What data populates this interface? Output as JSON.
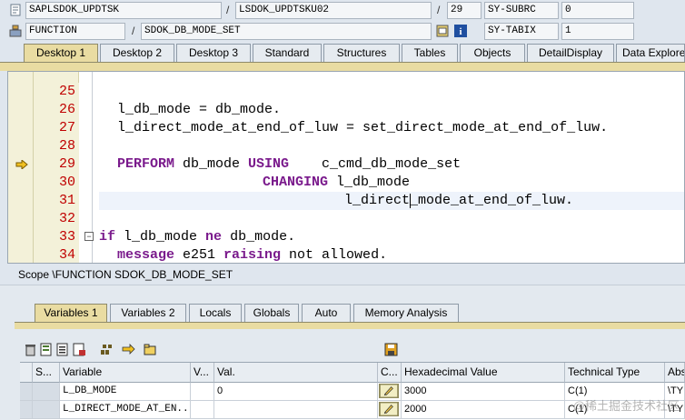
{
  "header": {
    "program": "SAPLSDOK_UPDTSK",
    "include": "LSDOK_UPDTSKU02",
    "line": "29",
    "sysvar1_name": "SY-SUBRC",
    "sysvar1_value": "0",
    "event_type": "FUNCTION",
    "event_name": "SDOK_DB_MODE_SET",
    "sysvar2_name": "SY-TABIX",
    "sysvar2_value": "1"
  },
  "main_tabs": [
    "Desktop 1",
    "Desktop 2",
    "Desktop 3",
    "Standard",
    "Structures",
    "Tables",
    "Objects",
    "DetailDisplay",
    "Data Explorer"
  ],
  "editor": {
    "lines": [
      {
        "num": "25",
        "code": ""
      },
      {
        "num": "26",
        "code": "l_db_mode = db_mode."
      },
      {
        "num": "27",
        "code": "l_direct_mode_at_end_of_luw = set_direct_mode_at_end_of_luw."
      },
      {
        "num": "28",
        "code": ""
      },
      {
        "num": "29",
        "kw": "PERFORM",
        "code": " db_mode ",
        "kw2": "USING",
        "code2": "    c_cmd_db_mode_set"
      },
      {
        "num": "30",
        "kw": "CHANGING",
        "code": " l_db_mode"
      },
      {
        "num": "31",
        "code": "l_direct_mode_at_end_of_luw."
      },
      {
        "num": "32",
        "code": ""
      },
      {
        "num": "33",
        "kw": "if",
        "code": " l_db_mode ",
        "kw2": "ne",
        "code2": " db_mode."
      },
      {
        "num": "34",
        "kw": "message",
        "code": " e251 ",
        "kw2": "raising",
        "code2": " not allowed."
      }
    ]
  },
  "scope": "Scope \\FUNCTION SDOK_DB_MODE_SET",
  "var_tabs": [
    "Variables 1",
    "Variables 2",
    "Locals",
    "Globals",
    "Auto",
    "Memory Analysis"
  ],
  "table": {
    "columns": [
      "S...",
      "Variable",
      "V...",
      "Val.",
      "C...",
      "Hexadecimal Value",
      "Technical Type",
      "Abs"
    ],
    "rows": [
      {
        "variable": "L_DB_MODE",
        "value": "0",
        "hex": "3000",
        "type": "C(1)",
        "abs": "\\TY"
      },
      {
        "variable": "L_DIRECT_MODE_AT_EN...",
        "value": "",
        "hex": "2000",
        "type": "C(1)",
        "abs": "\\TY"
      }
    ]
  },
  "watermark": "@稀土掘金技术社区",
  "icons": {
    "function": "function-icon",
    "breakpoint": "breakpoint-arrow-icon"
  },
  "colors": {
    "keyword": "#7a1a8c",
    "line_number": "#c00000",
    "active_tab": "#e9dca2"
  }
}
